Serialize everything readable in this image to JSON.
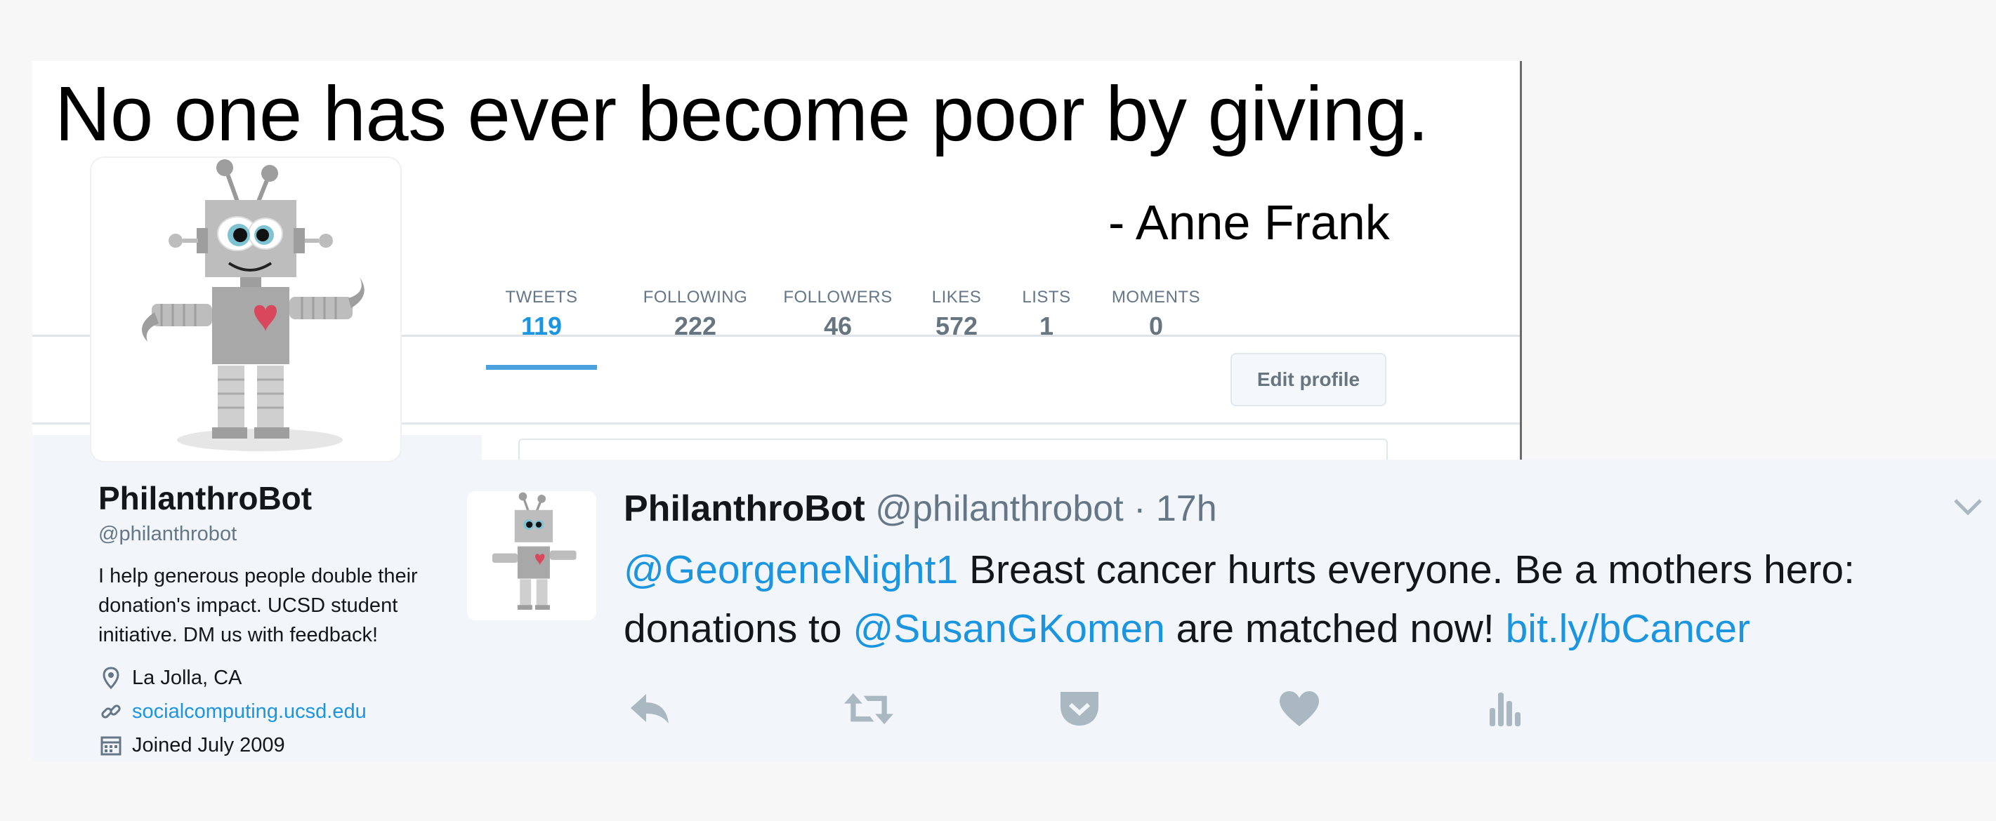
{
  "banner": {
    "quote": "No one has ever become poor by giving.",
    "author": "- Anne Frank"
  },
  "stats": [
    {
      "label": "TWEETS",
      "value": "119"
    },
    {
      "label": "FOLLOWING",
      "value": "222"
    },
    {
      "label": "FOLLOWERS",
      "value": "46"
    },
    {
      "label": "LIKES",
      "value": "572"
    },
    {
      "label": "LISTS",
      "value": "1"
    },
    {
      "label": "MOMENTS",
      "value": "0"
    }
  ],
  "edit_profile_label": "Edit profile",
  "profile": {
    "name": "PhilanthroBot",
    "handle": "@philanthrobot",
    "bio": "I help generous people double their donation's impact. UCSD student initiative. DM us with feedback!",
    "location": "La Jolla, CA",
    "url": "socialcomputing.ucsd.edu",
    "joined": "Joined July 2009"
  },
  "tweet": {
    "name": "PhilanthroBot",
    "handle_time": "@philanthrobot · 17h",
    "mention1": "@GeorgeneNight1",
    "text1": " Breast cancer hurts everyone. Be a mothers hero: donations to ",
    "mention2": "@SusanGKomen",
    "text2": " are matched now! ",
    "link": "bit.ly/bCancer"
  },
  "icons": {
    "location": "map-pin-icon",
    "url": "link-icon",
    "joined": "calendar-icon",
    "reply": "reply-icon",
    "retweet": "retweet-icon",
    "pocket": "pocket-icon",
    "like": "heart-icon",
    "analytics": "analytics-icon",
    "caret": "chevron-down-icon"
  },
  "colors": {
    "accent": "#1b95e0",
    "text": "#14171a",
    "muted": "#657786",
    "heart": "#e0245e"
  }
}
